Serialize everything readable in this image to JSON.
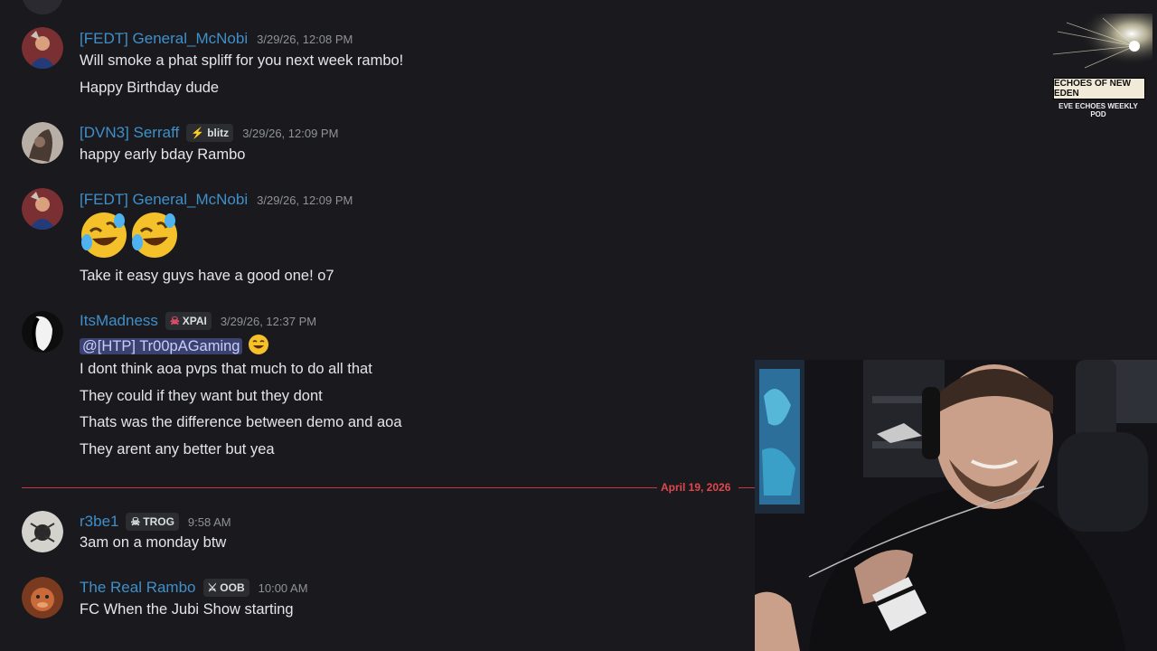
{
  "messages": [
    {
      "username": "[FEDT] General_McNobi",
      "timestamp": "3/29/26, 12:08 PM",
      "lines": [
        "Will smoke a phat spliff for you next week rambo!",
        "Happy Birthday dude"
      ]
    },
    {
      "username": "[DVN3] Serraff",
      "tag": "blitz",
      "timestamp": "3/29/26, 12:09 PM",
      "lines": [
        "happy early bday Rambo"
      ]
    },
    {
      "username": "[FEDT] General_McNobi",
      "timestamp": "3/29/26, 12:09 PM",
      "emojis": "rolling-on-floor-laughing x2",
      "lines": [
        "Take it easy guys have a good one! o7"
      ]
    },
    {
      "username": "ItsMadness",
      "tag": "XPAI",
      "timestamp": "3/29/26, 12:37 PM",
      "mention": "@[HTP] Tr00pAGaming",
      "lines": [
        "I dont think aoa pvps that much to do all that",
        "They could if they want but they dont",
        "Thats was the difference between demo and aoa",
        "They arent any better but yea"
      ]
    },
    {
      "username": "r3be1",
      "tag": "TROG",
      "timestamp": "9:58 AM",
      "lines": [
        "3am on a monday btw"
      ]
    },
    {
      "username": "The Real Rambo",
      "tag": "OOB",
      "timestamp": "10:00 AM",
      "lines": [
        "FC When the Jubi Show starting"
      ]
    }
  ],
  "date_divider": "April 19, 2026",
  "overlay_logo": {
    "title": "ECHOES OF NEW EDEN",
    "subtitle": "EVE ECHOES WEEKLY POD"
  },
  "colors": {
    "background": "#1a1a1e",
    "username": "#3f8fc9",
    "divider": "#c23b44",
    "mention_bg": "#3c4270"
  }
}
